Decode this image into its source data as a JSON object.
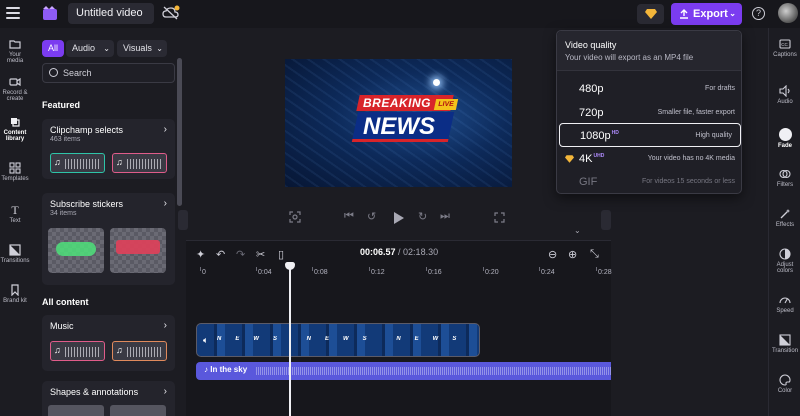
{
  "header": {
    "project_title": "Untitled video",
    "export_label": "Export",
    "help_label": "?"
  },
  "left_rail": {
    "items": [
      {
        "label": "Your media",
        "active": false
      },
      {
        "label": "Record & create",
        "active": false
      },
      {
        "label": "Content library",
        "active": true
      },
      {
        "label": "Templates",
        "active": false
      },
      {
        "label": "Text",
        "active": false
      },
      {
        "label": "Transitions",
        "active": false
      },
      {
        "label": "Brand kit",
        "active": false
      }
    ]
  },
  "library": {
    "filters": {
      "all": "All",
      "audio": "Audio",
      "visuals": "Visuals"
    },
    "search_placeholder": "Search",
    "featured_heading": "Featured",
    "cards": [
      {
        "title": "Clipchamp selects",
        "subtitle": "463 items"
      },
      {
        "title": "Subscribe stickers",
        "subtitle": "34 items"
      }
    ],
    "all_content_heading": "All content",
    "content_cards": [
      {
        "title": "Music"
      },
      {
        "title": "Shapes & annotations"
      }
    ]
  },
  "preview": {
    "video_text": {
      "breaking": "BREAKING",
      "live": "LIVE",
      "news": "NEWS"
    }
  },
  "timeline": {
    "current_time": "00:06.57",
    "total_time": "/ 02:18.30",
    "ruler": [
      "0",
      "0:04",
      "0:08",
      "0:12",
      "0:16",
      "0:20",
      "0:24",
      "0:28"
    ],
    "video_clip_label": "NEWS",
    "audio_clip_label": "In the sky"
  },
  "right_rail": {
    "items": [
      {
        "label": "Captions",
        "active": false
      },
      {
        "label": "Audio",
        "active": false
      },
      {
        "label": "Fade",
        "active": true
      },
      {
        "label": "Filters",
        "active": false
      },
      {
        "label": "Effects",
        "active": false
      },
      {
        "label": "Adjust colors",
        "active": false
      },
      {
        "label": "Speed",
        "active": false
      },
      {
        "label": "Transition",
        "active": false
      },
      {
        "label": "Color",
        "active": false
      }
    ]
  },
  "export_dropdown": {
    "title": "Video quality",
    "subtitle": "Your video will export as an MP4 file",
    "options": [
      {
        "quality": "480p",
        "badge": "",
        "description": "For drafts",
        "selected": false,
        "disabled": false,
        "premium": false
      },
      {
        "quality": "720p",
        "badge": "",
        "description": "Smaller file, faster export",
        "selected": false,
        "disabled": false,
        "premium": false
      },
      {
        "quality": "1080p",
        "badge": "HD",
        "description": "High quality",
        "selected": true,
        "disabled": false,
        "premium": false
      },
      {
        "quality": "4K",
        "badge": "UHD",
        "description": "Your video has no 4K media",
        "selected": false,
        "disabled": false,
        "premium": true
      },
      {
        "quality": "GIF",
        "badge": "",
        "description": "For videos 15 seconds or less",
        "selected": false,
        "disabled": true,
        "premium": false
      }
    ]
  },
  "colors": {
    "accent": "#7b3cf0",
    "audio_clip": "#5a58dc",
    "gem": "#f4b63a"
  }
}
